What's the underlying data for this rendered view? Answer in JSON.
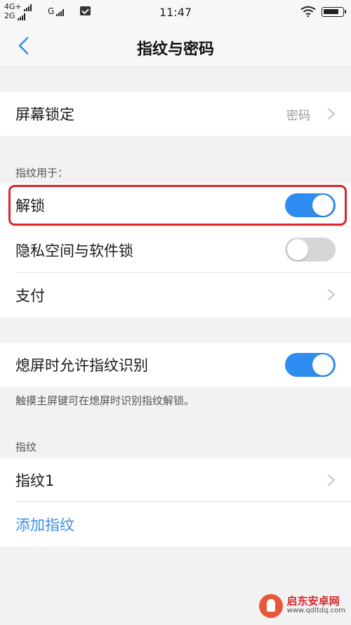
{
  "status": {
    "net_top": "4G+",
    "net_bottom": "2G",
    "net_g": "G",
    "time": "11:47"
  },
  "nav": {
    "title": "指纹与密码"
  },
  "screen_lock": {
    "label": "屏幕锁定",
    "value": "密码"
  },
  "fingerprint_use": {
    "header": "指纹用于：",
    "unlock": {
      "label": "解锁",
      "enabled": true
    },
    "privacy_lock": {
      "label": "隐私空间与软件锁",
      "enabled": false
    },
    "payment": {
      "label": "支付"
    }
  },
  "screen_off": {
    "label": "熄屏时允许指纹识别",
    "enabled": true,
    "note": "触摸主屏键可在熄屏时识别指纹解锁。"
  },
  "fingerprints": {
    "header": "指纹",
    "items": [
      {
        "label": "指纹1"
      }
    ],
    "add_label": "添加指纹"
  },
  "colors": {
    "accent": "#2f8cf0",
    "highlight": "#d9262c"
  },
  "watermark": {
    "name": "启东安卓网",
    "url": "www.qdltdq.com"
  }
}
